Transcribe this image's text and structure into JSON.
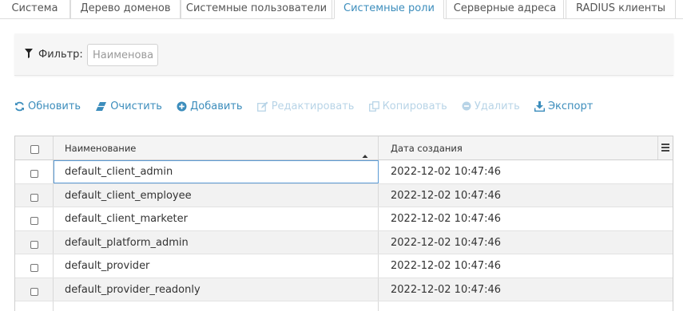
{
  "tabs": [
    {
      "label": "Система",
      "active": false
    },
    {
      "label": "Дерево доменов",
      "active": false
    },
    {
      "label": "Системные пользователи",
      "active": false
    },
    {
      "label": "Системные роли",
      "active": true
    },
    {
      "label": "Серверные адреса",
      "active": false
    },
    {
      "label": "RADIUS клиенты",
      "active": false
    }
  ],
  "filter": {
    "label": "Фильтр:",
    "placeholder": "Наименование",
    "icon": "filter-icon"
  },
  "toolbar": {
    "refresh": "Обновить",
    "clear": "Очистить",
    "add": "Добавить",
    "edit": "Редактировать",
    "copy": "Копировать",
    "delete": "Удалить",
    "export": "Экспорт"
  },
  "table": {
    "columns": {
      "name": "Наименование",
      "created": "Дата создания"
    },
    "sort": {
      "column": "name",
      "direction": "ascending"
    },
    "rows": [
      {
        "name": "default_client_admin",
        "created": "2022-12-02 10:47:46"
      },
      {
        "name": "default_client_employee",
        "created": "2022-12-02 10:47:46"
      },
      {
        "name": "default_client_marketer",
        "created": "2022-12-02 10:47:46"
      },
      {
        "name": "default_platform_admin",
        "created": "2022-12-02 10:47:46"
      },
      {
        "name": "default_provider",
        "created": "2022-12-02 10:47:46"
      },
      {
        "name": "default_provider_readonly",
        "created": "2022-12-02 10:47:46"
      }
    ]
  },
  "colors": {
    "accent": "#3c8dbc",
    "accent_disabled": "#b8d4e7",
    "row_alt": "#f2f2f2",
    "header_bg": "#f4f4f4"
  }
}
